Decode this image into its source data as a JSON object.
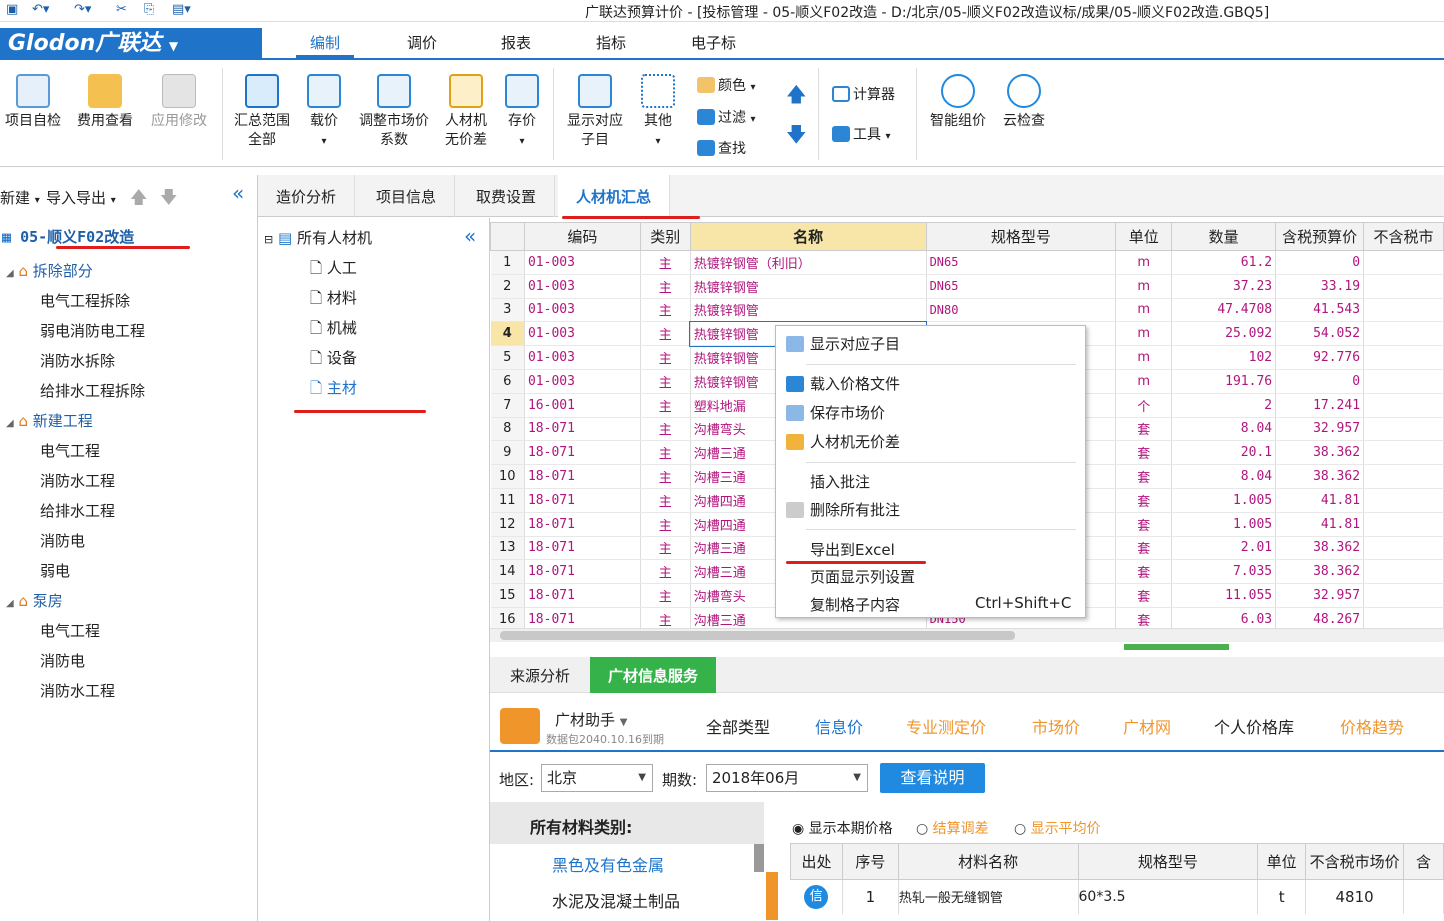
{
  "window": {
    "title": "广联达预算计价 - [投标管理 - 05-顺义F02改造 - D:/北京/05-顺义F02改造议标/成果/05-顺义F02改造.GBQ5]"
  },
  "brand": {
    "logo": "Glodon广联达"
  },
  "ribbon_tabs": [
    "编制",
    "调价",
    "报表",
    "指标",
    "电子标"
  ],
  "ribbon": {
    "buttons": [
      {
        "label": "项目自检"
      },
      {
        "label": "费用查看"
      },
      {
        "label": "应用修改"
      },
      {
        "label": "汇总范围\n全部"
      },
      {
        "label": "载价"
      },
      {
        "label": "调整市场价\n系数"
      },
      {
        "label": "人材机\n无价差"
      },
      {
        "label": "存价"
      },
      {
        "label": "显示对应\n子目"
      },
      {
        "label": "其他"
      },
      {
        "label": "智能组价"
      },
      {
        "label": "云检查"
      }
    ],
    "small": {
      "color": "颜色",
      "filter": "过滤",
      "find": "查找",
      "calculator": "计算器",
      "tools": "工具"
    }
  },
  "left_toolbar": {
    "new": "新建",
    "import_export": "导入导出"
  },
  "project_tree": {
    "root": "05-顺义F02改造",
    "groups": [
      {
        "name": "拆除部分",
        "items": [
          "电气工程拆除",
          "弱电消防电工程",
          "消防水拆除",
          "给排水工程拆除"
        ]
      },
      {
        "name": "新建工程",
        "items": [
          "电气工程",
          "消防水工程",
          "给排水工程",
          "消防电",
          "弱电"
        ]
      },
      {
        "name": "泵房",
        "items": [
          "电气工程",
          "消防电",
          "消防水工程"
        ]
      }
    ]
  },
  "main_tabs": [
    "造价分析",
    "项目信息",
    "取费设置",
    "人材机汇总"
  ],
  "category_tree": {
    "root": "所有人材机",
    "items": [
      "人工",
      "材料",
      "机械",
      "设备",
      "主材"
    ]
  },
  "grid": {
    "columns": [
      "编码",
      "类别",
      "名称",
      "规格型号",
      "单位",
      "数量",
      "含税预算价",
      "不含税市"
    ],
    "rows": [
      {
        "n": "1",
        "code": "01-003",
        "cat": "主",
        "name": "热镀锌钢管（利旧）",
        "spec": "DN65",
        "unit": "m",
        "qty": "61.2",
        "price": "0"
      },
      {
        "n": "2",
        "code": "01-003",
        "cat": "主",
        "name": "热镀锌钢管",
        "spec": "DN65",
        "unit": "m",
        "qty": "37.23",
        "price": "33.19"
      },
      {
        "n": "3",
        "code": "01-003",
        "cat": "主",
        "name": "热镀锌钢管",
        "spec": "DN80",
        "unit": "m",
        "qty": "47.4708",
        "price": "41.543"
      },
      {
        "n": "4",
        "code": "01-003",
        "cat": "主",
        "name": "热镀锌钢管",
        "spec": "",
        "unit": "m",
        "qty": "25.092",
        "price": "54.052"
      },
      {
        "n": "5",
        "code": "01-003",
        "cat": "主",
        "name": "热镀锌钢管",
        "spec": "",
        "unit": "m",
        "qty": "102",
        "price": "92.776"
      },
      {
        "n": "6",
        "code": "01-003",
        "cat": "主",
        "name": "热镀锌钢管",
        "spec": "",
        "unit": "m",
        "qty": "191.76",
        "price": "0"
      },
      {
        "n": "7",
        "code": "16-001",
        "cat": "主",
        "name": "塑料地漏",
        "spec": "",
        "unit": "个",
        "qty": "2",
        "price": "17.241"
      },
      {
        "n": "8",
        "code": "18-071",
        "cat": "主",
        "name": "沟槽弯头",
        "spec": "",
        "unit": "套",
        "qty": "8.04",
        "price": "32.957"
      },
      {
        "n": "9",
        "code": "18-071",
        "cat": "主",
        "name": "沟槽三通",
        "spec": "",
        "unit": "套",
        "qty": "20.1",
        "price": "38.362"
      },
      {
        "n": "10",
        "code": "18-071",
        "cat": "主",
        "name": "沟槽三通",
        "spec": "",
        "unit": "套",
        "qty": "8.04",
        "price": "38.362"
      },
      {
        "n": "11",
        "code": "18-071",
        "cat": "主",
        "name": "沟槽四通",
        "spec": "",
        "unit": "套",
        "qty": "1.005",
        "price": "41.81"
      },
      {
        "n": "12",
        "code": "18-071",
        "cat": "主",
        "name": "沟槽四通",
        "spec": "",
        "unit": "套",
        "qty": "1.005",
        "price": "41.81"
      },
      {
        "n": "13",
        "code": "18-071",
        "cat": "主",
        "name": "沟槽三通",
        "spec": "",
        "unit": "套",
        "qty": "2.01",
        "price": "38.362"
      },
      {
        "n": "14",
        "code": "18-071",
        "cat": "主",
        "name": "沟槽三通",
        "spec": "",
        "unit": "套",
        "qty": "7.035",
        "price": "38.362"
      },
      {
        "n": "15",
        "code": "18-071",
        "cat": "主",
        "name": "沟槽弯头",
        "spec": "",
        "unit": "套",
        "qty": "11.055",
        "price": "32.957"
      },
      {
        "n": "16",
        "code": "18-071",
        "cat": "主",
        "name": "沟槽三通",
        "spec": "DN150",
        "unit": "套",
        "qty": "6.03",
        "price": "48.267"
      }
    ]
  },
  "context_menu": [
    {
      "label": "显示对应子目",
      "shortcut": ""
    },
    {
      "label": "载入价格文件",
      "shortcut": ""
    },
    {
      "label": "保存市场价",
      "shortcut": ""
    },
    {
      "label": "人材机无价差",
      "shortcut": ""
    },
    {
      "label": "插入批注",
      "shortcut": ""
    },
    {
      "label": "删除所有批注",
      "shortcut": ""
    },
    {
      "label": "导出到Excel",
      "shortcut": ""
    },
    {
      "label": "页面显示列设置",
      "shortcut": ""
    },
    {
      "label": "复制格子内容",
      "shortcut": "Ctrl+Shift+C"
    }
  ],
  "bottom": {
    "tabs": [
      "来源分析",
      "广材信息服务"
    ],
    "assistant": {
      "title": "广材助手",
      "sub": "数据包2040.10.16到期"
    },
    "info_tabs": [
      "全部类型",
      "信息价",
      "专业测定价",
      "市场价",
      "广材网",
      "个人价格库",
      "价格趋势"
    ],
    "region_label": "地区:",
    "region_value": "北京",
    "period_label": "期数:",
    "period_value": "2018年06月",
    "explain_button": "查看说明",
    "categories_title": "所有材料类别:",
    "categories": [
      "黑色及有色金属",
      "水泥及混凝土制品"
    ],
    "radios": [
      "显示本期价格",
      "结算调差",
      "显示平均价"
    ],
    "table_columns": [
      "出处",
      "序号",
      "材料名称",
      "规格型号",
      "单位",
      "不含税市场价",
      "含"
    ],
    "table_rows": [
      {
        "src": "信",
        "n": "1",
        "name": "热轧一般无缝钢管",
        "spec": "60*3.5",
        "unit": "t",
        "price": "4810"
      }
    ]
  }
}
